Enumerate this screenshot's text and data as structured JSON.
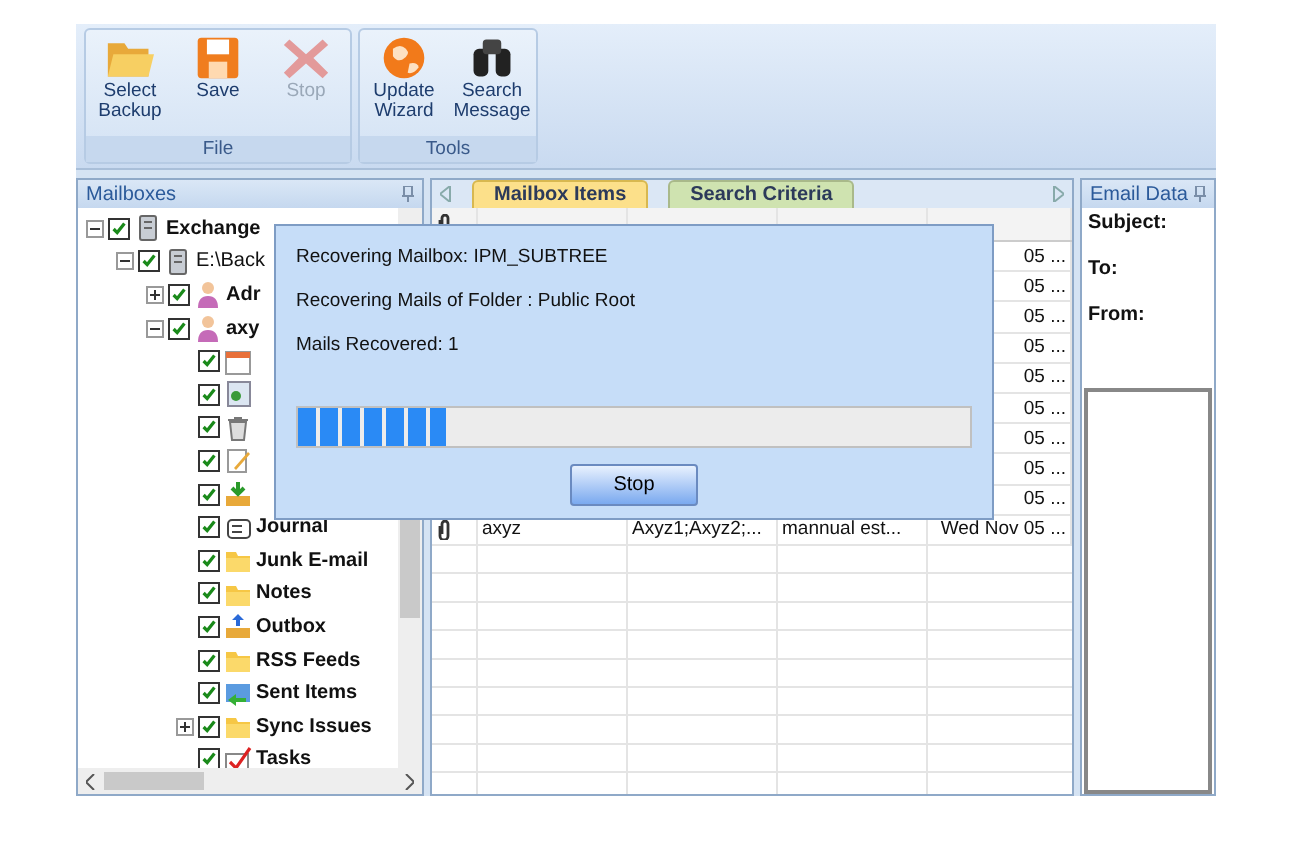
{
  "ribbon": {
    "groups": [
      {
        "label": "File",
        "buttons": [
          {
            "kind": "open",
            "label": "Select Backup",
            "disabled": false
          },
          {
            "kind": "save",
            "label": "Save",
            "disabled": false
          },
          {
            "kind": "stop",
            "label": "Stop",
            "disabled": true
          }
        ]
      },
      {
        "label": "Tools",
        "buttons": [
          {
            "kind": "globe",
            "label": "Update Wizard",
            "disabled": false
          },
          {
            "kind": "binoculars",
            "label": "Search Message",
            "disabled": false
          }
        ]
      }
    ]
  },
  "mailboxes": {
    "title": "Mailboxes",
    "tree": [
      {
        "label": "Exchange",
        "kind": "server",
        "checked": true,
        "expanded": true,
        "children": [
          {
            "label": "E:\\Back",
            "kind": "server",
            "checked": true,
            "expanded": true,
            "bold": false,
            "children": [
              {
                "label": "Adr",
                "kind": "user",
                "checked": true,
                "expanded": false
              },
              {
                "label": "axy",
                "kind": "user",
                "checked": true,
                "expanded": true,
                "children": [
                  {
                    "kind": "calendar",
                    "checked": true
                  },
                  {
                    "kind": "contacts",
                    "checked": true
                  },
                  {
                    "kind": "trash",
                    "checked": true
                  },
                  {
                    "kind": "note",
                    "checked": true
                  },
                  {
                    "kind": "inbox",
                    "checked": true
                  },
                  {
                    "label": "Journal",
                    "kind": "journal",
                    "checked": true
                  },
                  {
                    "label": "Junk E-mail",
                    "kind": "folder",
                    "checked": true
                  },
                  {
                    "label": "Notes",
                    "kind": "folder",
                    "checked": true
                  },
                  {
                    "label": "Outbox",
                    "kind": "outbox",
                    "checked": true
                  },
                  {
                    "label": "RSS Feeds",
                    "kind": "folder",
                    "checked": true
                  },
                  {
                    "label": "Sent Items",
                    "kind": "sent",
                    "checked": true
                  },
                  {
                    "label": "Sync Issues",
                    "kind": "folder",
                    "checked": true,
                    "expanded": false
                  },
                  {
                    "label": "Tasks",
                    "kind": "tasks",
                    "checked": true
                  }
                ]
              }
            ]
          }
        ]
      }
    ]
  },
  "center": {
    "tabs": [
      {
        "label": "Mailbox Items",
        "selected": true
      },
      {
        "label": "Search Criteria",
        "selected": false
      }
    ],
    "rows": [
      {
        "column_5": "05 ..."
      },
      {
        "column_5": "05 ..."
      },
      {
        "column_5": "05 ..."
      },
      {
        "column_5": "05 ..."
      },
      {
        "column_5": "05 ..."
      },
      {
        "column_5": "05 ..."
      },
      {
        "column_5": "05 ..."
      },
      {
        "column_5": "05 ..."
      },
      {
        "column_5": "05 ..."
      },
      {
        "attachment": true,
        "column_2": "axyz",
        "column_3": "Axyz1;Axyz2;...",
        "column_4": "mannual est...",
        "column_5": "Wed Nov 05 ..."
      }
    ]
  },
  "email_data": {
    "title": "Email Data",
    "fields": [
      "Subject:",
      "To:",
      "From:"
    ]
  },
  "dialog": {
    "lines": [
      "Recovering Mailbox: IPM_SUBTREE",
      "Recovering Mails of Folder : Public Root",
      "Mails Recovered: 1"
    ],
    "level": 0.22,
    "button": "Stop"
  }
}
